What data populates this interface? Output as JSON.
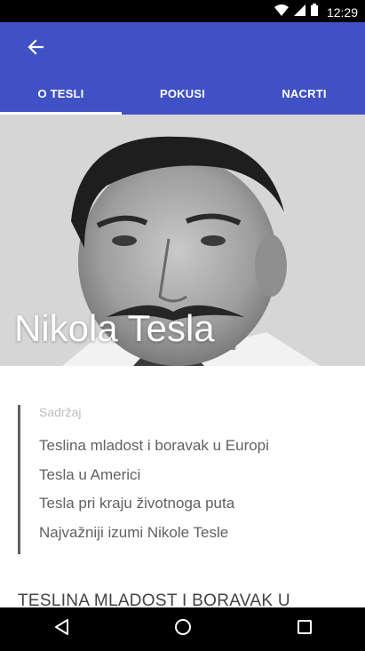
{
  "status_bar": {
    "time": "12:29"
  },
  "app_bar": {
    "tabs": [
      {
        "label": "O TESLI",
        "selected": true
      },
      {
        "label": "POKUSI",
        "selected": false
      },
      {
        "label": "NACRTI",
        "selected": false
      }
    ],
    "color": "#3f51c5"
  },
  "hero": {
    "title": "Nikola Tesla"
  },
  "toc": {
    "heading": "Sadržaj",
    "items": [
      "Teslina mladost i boravak u Europi",
      "Tesla u Americi",
      "Tesla pri kraju životnoga puta",
      "Najvažniji izumi Nikole Tesle"
    ]
  },
  "section": {
    "heading": "TESLINA MLADOST I BORAVAK U"
  }
}
